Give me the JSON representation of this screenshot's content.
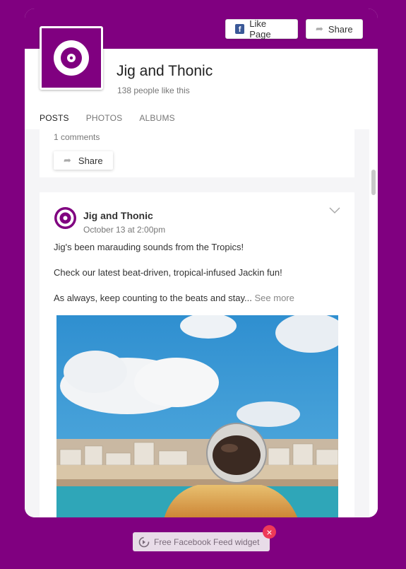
{
  "header": {
    "like_label": "Like Page",
    "share_label": "Share",
    "page_name": "Jig and Thonic",
    "likes_text": "138 people like this"
  },
  "tabs": [
    {
      "label": "POSTS",
      "active": true
    },
    {
      "label": "PHOTOS",
      "active": false
    },
    {
      "label": "ALBUMS",
      "active": false
    }
  ],
  "prev_post": {
    "comments_text": "1 comments",
    "share_label": "Share"
  },
  "post": {
    "author": "Jig and Thonic",
    "date": "October 13 at 2:00pm",
    "line1": "Jig's been marauding sounds from the Tropics!",
    "line2": "Check our latest beat-driven, tropical-infused Jackin fun!",
    "line3": "As always, keep counting to the beats and stay...",
    "see_more": "See more"
  },
  "badge": {
    "label": "Free Facebook Feed widget"
  },
  "colors": {
    "brand": "#800080",
    "facebook": "#3b5998",
    "close": "#ee3a57"
  }
}
